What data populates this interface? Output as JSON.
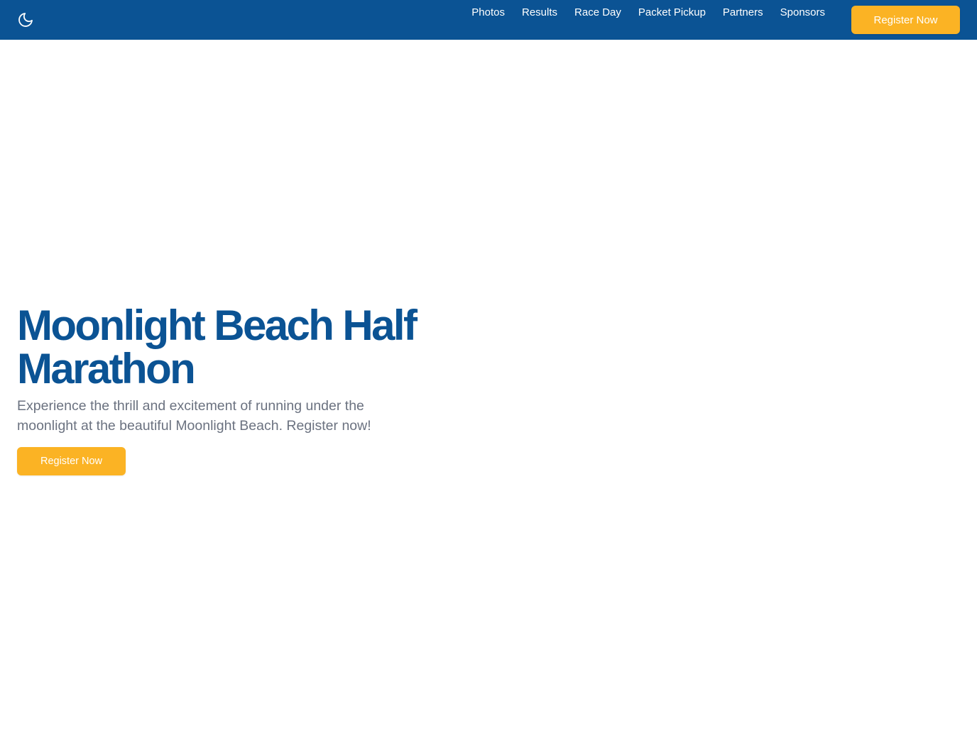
{
  "nav": {
    "theme_icon": "moon-icon",
    "links": [
      "Photos",
      "Results",
      "Race Day",
      "Packet Pickup",
      "Partners",
      "Sponsors"
    ],
    "register_label": "Register Now"
  },
  "hero": {
    "title": "Moonlight Beach Half Marathon",
    "subtitle": "Experience the thrill and excitement of running under the moonlight at the beautiful Moonlight Beach. Register now!",
    "register_label": "Register Now"
  },
  "colors": {
    "primary": "#0b5394",
    "accent": "#fbb324",
    "subtitle_text": "#6b7280"
  }
}
